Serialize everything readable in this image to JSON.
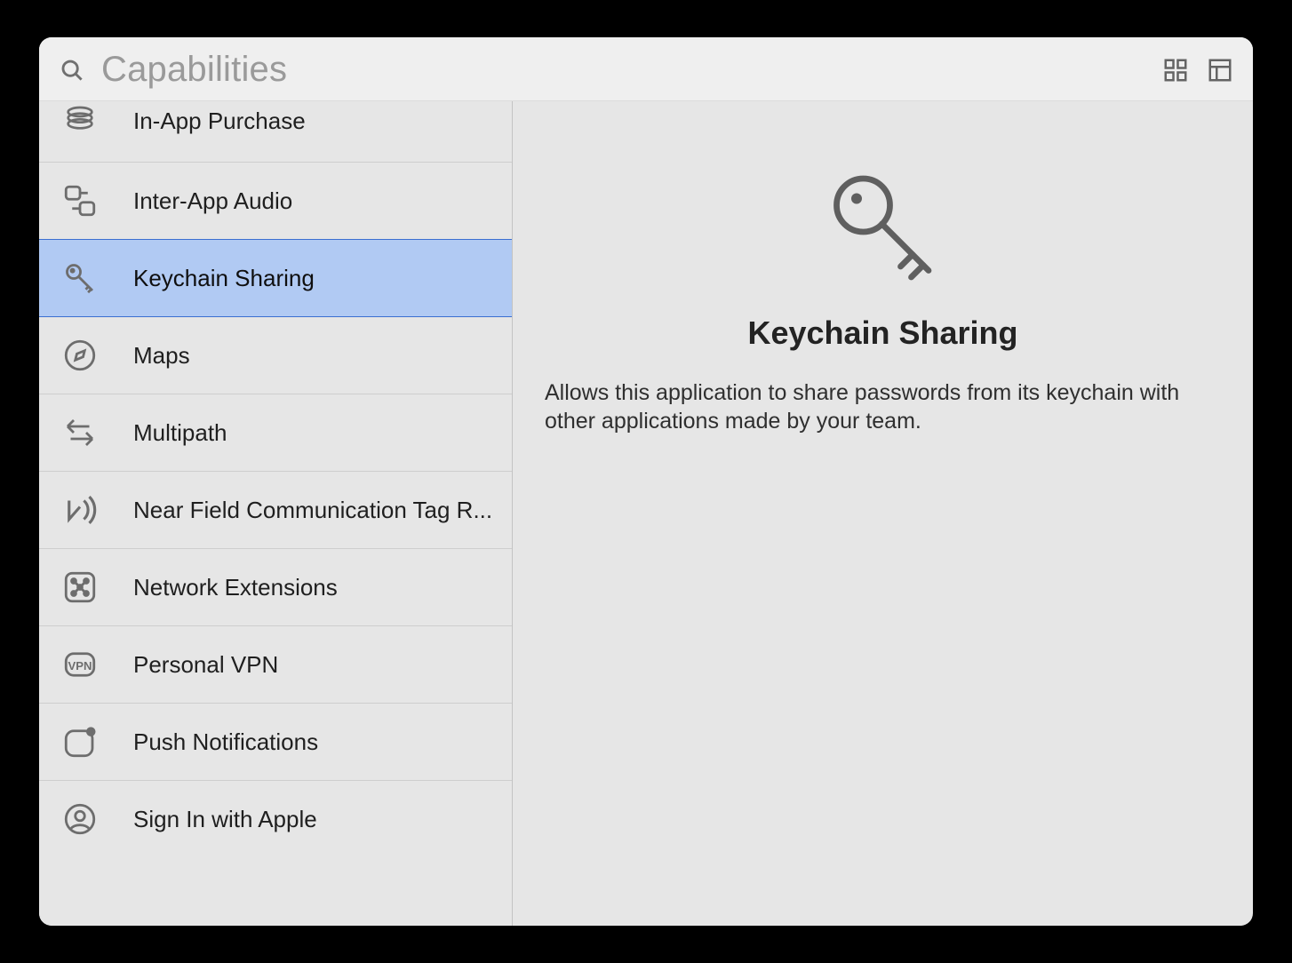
{
  "toolbar": {
    "search_placeholder": "Capabilities"
  },
  "sidebar": {
    "items": [
      {
        "label": "In-App Purchase"
      },
      {
        "label": "Inter-App Audio"
      },
      {
        "label": "Keychain Sharing"
      },
      {
        "label": "Maps"
      },
      {
        "label": "Multipath"
      },
      {
        "label": "Near Field Communication Tag R..."
      },
      {
        "label": "Network Extensions"
      },
      {
        "label": "Personal VPN"
      },
      {
        "label": "Push Notifications"
      },
      {
        "label": "Sign In with Apple"
      }
    ],
    "selected_index": 2
  },
  "detail": {
    "title": "Keychain Sharing",
    "description": "Allows this application to share passwords from its keychain with other applications made by your team."
  }
}
